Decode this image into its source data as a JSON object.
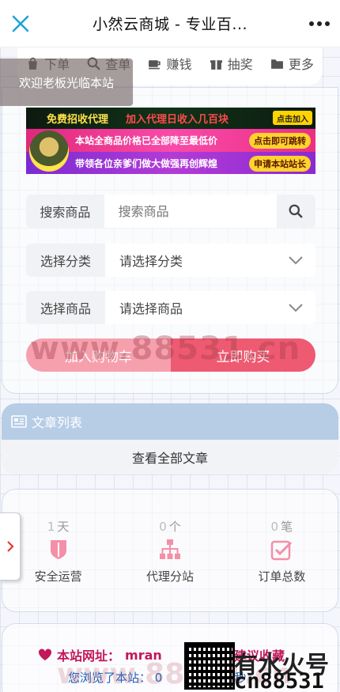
{
  "header": {
    "title": "小然云商城 - 专业百...",
    "close_icon": "close-icon",
    "more_icon": "more-dots-icon"
  },
  "nav": {
    "items": [
      {
        "label": "下单",
        "icon": "shopping-bag-icon"
      },
      {
        "label": "查单",
        "icon": "search-icon"
      },
      {
        "label": "赚钱",
        "icon": "coffee-cup-icon"
      },
      {
        "label": "抽奖",
        "icon": "gift-icon"
      },
      {
        "label": "更多",
        "icon": "folder-open-icon"
      }
    ]
  },
  "welcome_toast": "欢迎老板光临本站",
  "banner": {
    "row1_left": "免费招收代理",
    "row1_right": "加入代理日收入几百块",
    "row1_button": "点击加入",
    "row2_text": "本站全商品价格已全部降至最低价",
    "row2_button": "点击即可跳转",
    "row3_text": "带领各位亲爹们做大做强再创辉煌",
    "row3_button": "申请本站站长"
  },
  "form": {
    "search_label": "搜索商品",
    "search_placeholder": "搜索商品",
    "category_label": "选择分类",
    "category_value": "请选择分类",
    "product_label": "选择商品",
    "product_value": "请选择商品"
  },
  "actions": {
    "add_to_cart": "加入购物车",
    "buy_now": "立即购买"
  },
  "watermark": "www.88531.cn",
  "articles": {
    "title": "文章列表",
    "view_all": "查看全部文章"
  },
  "stats": [
    {
      "value": "1",
      "unit": "天",
      "label": "安全运营"
    },
    {
      "value": "0",
      "unit": "个",
      "label": "代理分站"
    },
    {
      "value": "0",
      "unit": "笔",
      "label": "订单总数"
    }
  ],
  "footer": {
    "site_prefix": "本站网址：",
    "site_url": "mran",
    "suggest": "建议收藏",
    "visited_prefix": "您浏览了本站：",
    "visited_value": "0",
    "visited_suffix": "分0秒",
    "brand_top": "有水火号",
    "brand_bottom": "cn88531",
    "watermark": "www.88531.cn"
  },
  "colors": {
    "accent_pink": "#ee5a72",
    "light_pink": "#f6a0ae",
    "article_header": "#b7cde6",
    "footer_text": "#c2185b"
  }
}
